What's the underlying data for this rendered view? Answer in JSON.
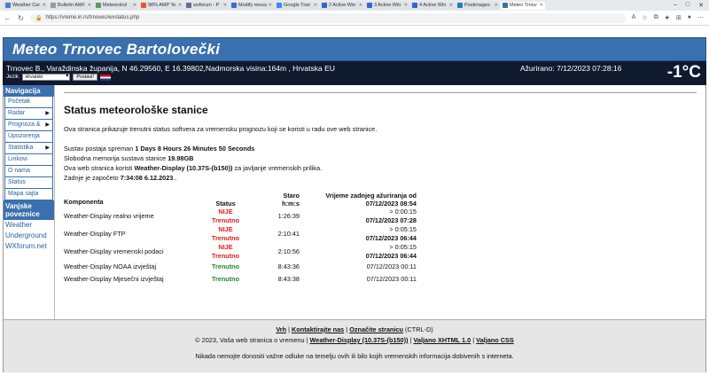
{
  "browser": {
    "tabs": [
      {
        "label": "Weather Cor",
        "color": "#4a7bd4"
      },
      {
        "label": "Bulletin AMF",
        "color": "#999999"
      },
      {
        "label": "Meteorološ",
        "color": "#5a9a5a"
      },
      {
        "label": "98% AMP Te",
        "color": "#e05b2a"
      },
      {
        "label": "wxforum - P",
        "color": "#6a6a9a"
      },
      {
        "label": "Modify messa",
        "color": "#3a6cc8"
      },
      {
        "label": "Google Tran",
        "color": "#4285f4"
      },
      {
        "label": "2 Active Win",
        "color": "#3366cc"
      },
      {
        "label": "3 Active Win",
        "color": "#3366cc"
      },
      {
        "label": "4 Active Win",
        "color": "#3366cc"
      },
      {
        "label": "Postimages",
        "color": "#2a7ab8"
      },
      {
        "label": "Meteo Trnov",
        "color": "#3a70ad"
      }
    ],
    "url": "https://vreme.in.rs/trnovec/wxstatus.php"
  },
  "header": {
    "site_title": "Meteo Trnovec Bartolovečki",
    "location": "Trnovec B., Varaždinska županija, N 46.29560, E 16.39802,Nadmorska visina:164m , Hrvatska EU",
    "updated": "Ažurirano:  7/12/2023  07:28:16",
    "temperature": "-1°C",
    "lang_label": "Jezik:",
    "lang_value": "Hrvatski",
    "lang_button": "Postavi!"
  },
  "sidebar": {
    "nav_heading": "Navigacija",
    "items": [
      {
        "label": "Početak",
        "arrow": false
      },
      {
        "label": "Radar",
        "arrow": true
      },
      {
        "label": "Prognoza &",
        "arrow": true
      },
      {
        "label": "Upozorenja",
        "arrow": false
      },
      {
        "label": "Statistika",
        "arrow": true
      },
      {
        "label": "Linkovi",
        "arrow": false
      },
      {
        "label": "O nama",
        "arrow": false
      },
      {
        "label": "Status",
        "arrow": false
      },
      {
        "label": "Mapa sajta",
        "arrow": false
      }
    ],
    "links_heading": "Vanjske poveznice",
    "links": [
      "Weather",
      "Underground",
      "WXforum.net"
    ]
  },
  "main": {
    "title": "Status meteorološke stanice",
    "intro": "Ova stranica prikazuje trenutni status softvera za vremensku prognozu koji se koristi u radu ove web stranice.",
    "uptime_label": "Sustav postaja spreman ",
    "uptime_value": "1 Days 8 Hours 26 Minutes 50 Seconds",
    "memory_label": "Slobodna memorija sustava stanice ",
    "memory_value": "19.98GB",
    "software_label": "Ova web stranica koristi ",
    "software_value": "Weather-Display (10.37S-(b150))",
    "software_suffix": " za javljanje vremenskih prilika.",
    "started_label": "Zadnje je započeto ",
    "started_value": "7:34:08 6.12.2023",
    "started_suffix": "..",
    "table": {
      "headers": {
        "component": "Komponenta",
        "status": "Status",
        "age_1": "Staro",
        "age_2": "h:m:s",
        "last_1": "Vrijeme zadnjeg ažuriranja od",
        "last_2": "07/12/2023 08:54"
      },
      "rows": [
        {
          "name": "Weather-Display realno vrijeme",
          "status_1": "NIJE",
          "status_2": "Trenutno",
          "ok": false,
          "age": "1:26:39",
          "limit": "> 0:00:15",
          "last": "07/12/2023 07:28"
        },
        {
          "name": "Weather-Display FTP",
          "status_1": "NIJE",
          "status_2": "Trenutno",
          "ok": false,
          "age": "2:10:41",
          "limit": "> 0:05:15",
          "last": "07/12/2023 06:44"
        },
        {
          "name": "Weather-Display vremenski podaci",
          "status_1": "NIJE",
          "status_2": "Trenutno",
          "ok": false,
          "age": "2:10:56",
          "limit": "> 0:05:15",
          "last": "07/12/2023 06:44"
        },
        {
          "name": "Weather-Display NOAA izvještaj",
          "status_1": "",
          "status_2": "Trenutno",
          "ok": true,
          "age": "8:43:36",
          "limit": "",
          "last": "07/12/2023 00:11"
        },
        {
          "name": "Weather-Display Mjesečni izvještaj",
          "status_1": "",
          "status_2": "Trenutno",
          "ok": true,
          "age": "8:43:38",
          "limit": "",
          "last": "07/12/2023 00:11"
        }
      ]
    }
  },
  "footer": {
    "top": "Vrh",
    "contact": "Kontaktirajte nas",
    "mark": "Označite stranicu",
    "mark_hint": " (CTRL-D)",
    "copyright": "© 2023, Vaša web stranica o vremenu | ",
    "wd_link": "Weather-Display (10.37S-(b150))",
    "xhtml": "Valjano XHTML 1.0",
    "css": "Valjano CSS",
    "note": "Nikada nemojte donositi važne odluke na temelju ovih ili bilo kojih vremenskih informacija dobivenih s interneta."
  }
}
